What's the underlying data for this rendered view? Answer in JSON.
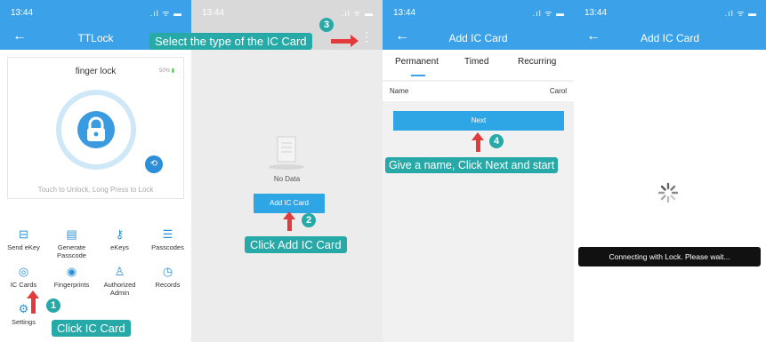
{
  "panel1": {
    "time": "13:44",
    "signal": ".ıl ᯤ ▬",
    "title": "TTLock",
    "lock_name": "finger lock",
    "battery": "50%",
    "touch_text": "Touch to Unlock, Long Press to Lock",
    "menu": [
      {
        "label": "Send eKey",
        "icon": "send-ekey-icon"
      },
      {
        "label": "Generate Passcode",
        "icon": "generate-passcode-icon"
      },
      {
        "label": "eKeys",
        "icon": "ekeys-icon"
      },
      {
        "label": "Passcodes",
        "icon": "passcodes-icon"
      },
      {
        "label": "IC Cards",
        "icon": "ic-cards-icon"
      },
      {
        "label": "Fingerprints",
        "icon": "fingerprints-icon"
      },
      {
        "label": "Authorized Admin",
        "icon": "authorized-admin-icon"
      },
      {
        "label": "Records",
        "icon": "records-icon"
      },
      {
        "label": "Settings",
        "icon": "settings-icon"
      }
    ]
  },
  "panel2": {
    "time": "13:44",
    "signal": ".ıl ᯤ ▬",
    "no_data": "No Data",
    "add_button": "Add IC Card"
  },
  "panel3": {
    "time": "13:44",
    "signal": ".ıl ᯤ ▬",
    "title": "Add IC Card",
    "tabs": [
      "Permanent",
      "Timed",
      "Recurring"
    ],
    "name_label": "Name",
    "name_value": "Carol",
    "next_button": "Next"
  },
  "panel4": {
    "time": "13:44",
    "signal": ".ıl ᯤ ▬",
    "title": "Add IC Card",
    "toast": "Connecting with Lock. Please wait..."
  },
  "annotations": {
    "step1_num": "1",
    "step1_text": "Click IC Card",
    "step2_num": "2",
    "step2_text": "Click Add IC Card",
    "step3_num": "3",
    "step3_text": "Select the type of the IC Card",
    "step4_num": "4",
    "step4_text": "Give a name, Click Next and start"
  },
  "colors": {
    "header_blue": "#3ba1e8",
    "button_blue": "#2ea6e6",
    "callout_teal": "#27a9a8",
    "arrow_red": "#e23b3b"
  }
}
